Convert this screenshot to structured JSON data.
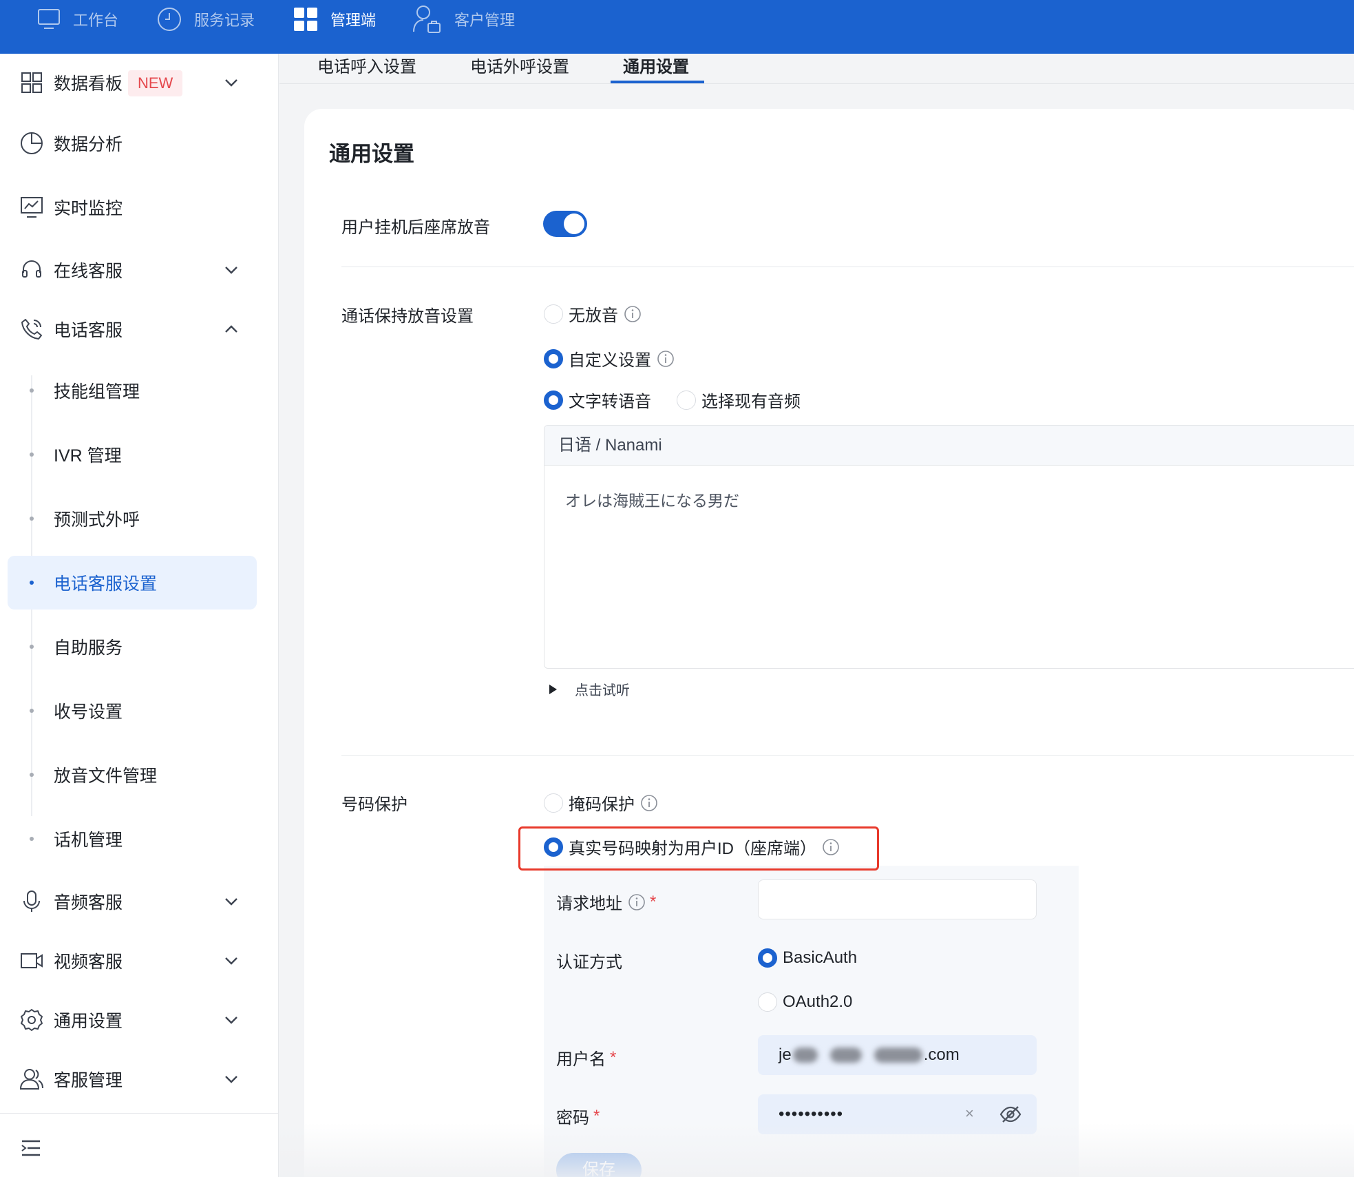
{
  "topbar": {
    "items": [
      {
        "label": "工作台",
        "icon": "monitor-icon",
        "active": false
      },
      {
        "label": "服务记录",
        "icon": "clock-icon",
        "active": false
      },
      {
        "label": "管理端",
        "icon": "grid-icon",
        "active": true
      },
      {
        "label": "客户管理",
        "icon": "user-bag-icon",
        "active": false
      }
    ],
    "bg_color": "#1b62cf"
  },
  "sidebar": {
    "items": [
      {
        "label": "数据看板",
        "icon": "dashboard-icon",
        "badge": "NEW",
        "chevron": "down"
      },
      {
        "label": "数据分析",
        "icon": "pie-chart-icon"
      },
      {
        "label": "实时监控",
        "icon": "monitor-chart-icon"
      },
      {
        "label": "在线客服",
        "icon": "headset-icon",
        "chevron": "down"
      },
      {
        "label": "电话客服",
        "icon": "phone-icon",
        "chevron": "up"
      },
      {
        "label": "音频客服",
        "icon": "microphone-icon",
        "chevron": "down"
      },
      {
        "label": "视频客服",
        "icon": "video-icon",
        "chevron": "down"
      },
      {
        "label": "通用设置",
        "icon": "gear-icon",
        "chevron": "down"
      },
      {
        "label": "客服管理",
        "icon": "users-icon",
        "chevron": "down"
      }
    ],
    "sub_items": [
      {
        "label": "技能组管理"
      },
      {
        "label": "IVR 管理"
      },
      {
        "label": "预测式外呼"
      },
      {
        "label": "电话客服设置",
        "active": true
      },
      {
        "label": "自助服务"
      },
      {
        "label": "收号设置"
      },
      {
        "label": "放音文件管理"
      },
      {
        "label": "话机管理"
      }
    ],
    "collapse_icon": "menu-collapse-icon"
  },
  "tabs": [
    {
      "label": "电话呼入设置",
      "active": false
    },
    {
      "label": "电话外呼设置",
      "active": false
    },
    {
      "label": "通用设置",
      "active": true
    }
  ],
  "main": {
    "title": "通用设置",
    "hangup_music": {
      "label": "用户挂机后座席放音",
      "enabled": true
    },
    "hold_music": {
      "label": "通话保持放音设置",
      "options": [
        {
          "label": "无放音",
          "checked": false
        },
        {
          "label": "自定义设置",
          "checked": true
        }
      ],
      "source_options": [
        {
          "label": "文字转语音",
          "checked": true
        },
        {
          "label": "选择现有音频",
          "checked": false
        }
      ],
      "voice": "日语 / Nanami",
      "text": "オレは海賊王になる男だ",
      "preview_label": "点击试听"
    },
    "number_protection": {
      "label": "号码保护",
      "options": [
        {
          "label": "掩码保护",
          "checked": false
        },
        {
          "label": "真实号码映射为用户ID（座席端）",
          "checked": true
        }
      ],
      "request_url": {
        "label": "请求地址",
        "value": ""
      },
      "auth": {
        "label": "认证方式",
        "options": [
          {
            "label": "BasicAuth",
            "checked": true
          },
          {
            "label": "OAuth2.0",
            "checked": false
          }
        ]
      },
      "username": {
        "label": "用户名",
        "prefix": "je",
        "suffix": ".com"
      },
      "password": {
        "label": "密码",
        "value": "••••••••••",
        "clear_symbol": "×"
      },
      "save_label": "保存"
    },
    "accent_color": "#1b62cf",
    "highlight_color": "#e8392b"
  }
}
